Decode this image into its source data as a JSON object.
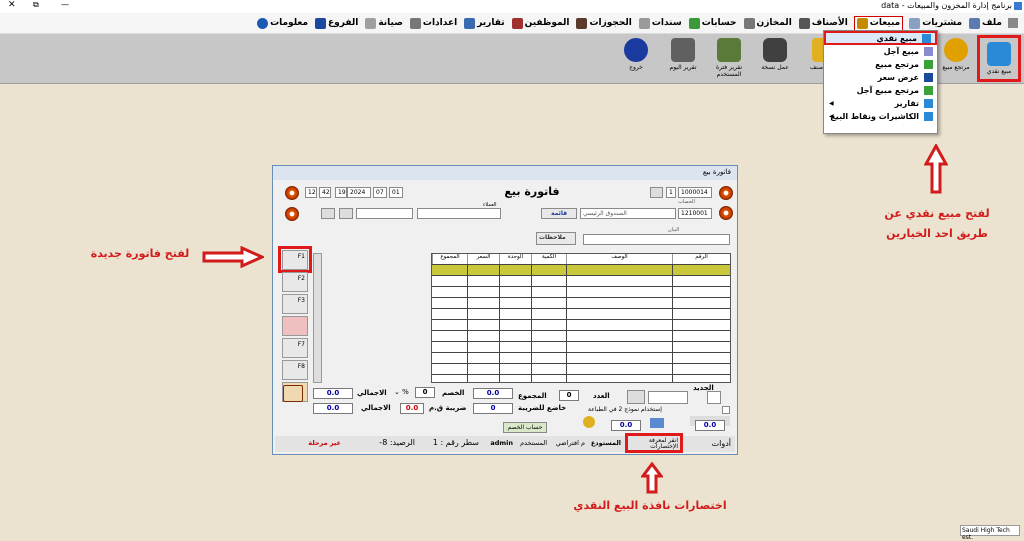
{
  "window": {
    "title": "برنامج إدارة المخزون والمبيعات - data",
    "controls": [
      "✕",
      "⧉",
      "—"
    ]
  },
  "menu": [
    {
      "label": "ملف",
      "color": "#5a7ab0"
    },
    {
      "label": "مشتريات",
      "color": "#8aa0c0"
    },
    {
      "label": "مبيعات",
      "color": "#c58a00"
    },
    {
      "label": "الأصناف",
      "color": "#555"
    },
    {
      "label": "المخازن",
      "color": "#777"
    },
    {
      "label": "حسابات",
      "color": "#3a9a3a"
    },
    {
      "label": "سندات",
      "color": "#9a9a9a"
    },
    {
      "label": "الحجوزات",
      "color": "#5a3a2a"
    },
    {
      "label": "الموظفين",
      "color": "#a03030"
    },
    {
      "label": "تقارير",
      "color": "#3a6ab0"
    },
    {
      "label": "اعدادات",
      "color": "#777"
    },
    {
      "label": "صيانة",
      "color": "#a0a0a0"
    },
    {
      "label": "الفروع",
      "color": "#1a4aa0"
    },
    {
      "label": "معلومات",
      "color": "#1a5ab0"
    }
  ],
  "toolbar": {
    "right": [
      {
        "label": "مبيع نقدي",
        "color": "#2a8ad8"
      },
      {
        "label": "مرتجع مبيع",
        "color": "#e0a000"
      },
      {
        "label": "",
        "color": "#4a9a4a"
      },
      {
        "label": "",
        "color": "#9a9ad8"
      },
      {
        "label": "",
        "color": "#e0c040"
      }
    ],
    "left": [
      {
        "label": "خروج",
        "color": "#1a3aa0"
      },
      {
        "label": "تقرير اليوم",
        "color": "#606060"
      },
      {
        "label": "تقرير فترة المستخدم",
        "color": "#5a7a3a"
      },
      {
        "label": "عمل نسخة",
        "color": "#404040"
      },
      {
        "label": "حذف صنف",
        "color": "#e0b020"
      }
    ]
  },
  "dropdown": [
    {
      "label": "مبيع نقدي",
      "color": "#2a8ad8",
      "sub": false
    },
    {
      "label": "مبيع آجل",
      "color": "#8a8ad0",
      "sub": false
    },
    {
      "label": "مرتجع مبيع",
      "color": "#3aa03a",
      "sub": false
    },
    {
      "label": "عرض سعر",
      "color": "#1a4a9a",
      "sub": false
    },
    {
      "label": "مرتجع مبيع آجل",
      "color": "#3aa03a",
      "sub": false
    },
    {
      "label": "تقارير",
      "color": "#2a8ad8",
      "sub": true
    },
    {
      "label": "الكاشيرات ونقاط البيع",
      "color": "#2a8ad8",
      "sub": true
    }
  ],
  "invoice": {
    "window_title": "فاتورة بيع",
    "heading": "فاتورة بيع",
    "invoice_no": "1000014",
    "counter": "1",
    "date": {
      "day": "01",
      "month": "07",
      "year": "2024"
    },
    "time": {
      "h": "12",
      "m": "42",
      "s": "19"
    },
    "account_label": "الحساب",
    "account_code": "1210001",
    "account_name": "الصندوق الرئيسي",
    "list_button": "قائمة",
    "customer_label": "العملاء",
    "note_label": "البيان",
    "notes_button": "ملاحظات",
    "columns": [
      "الرقم",
      "الوصف",
      "الكمية",
      "الوحدة",
      "السعر",
      "المجموع"
    ],
    "side_keys": [
      "F1",
      "F2",
      "F3",
      "",
      "F7",
      "F8",
      ""
    ],
    "totals": {
      "barcode_label": "الجديد",
      "count_label": "العدد",
      "count": "0",
      "sum_label": "المجموع",
      "sum": "0.0",
      "discount_label": "الخصم",
      "discount": "0",
      "percent": "%",
      "total_label": "الاجمالي",
      "total": "0.0",
      "taxable_label": "خاضع للضريبة",
      "taxable": "0",
      "vat_label": "ضريبة ق.م",
      "vat": "0.0",
      "grand_label": "الاجمالي",
      "grand": "0.0",
      "print_option": "إستخدام نموذج 2 في الطباعة",
      "calc_discount": "حساب الخصم",
      "paid": "0.0",
      "change": "0.0"
    },
    "status": {
      "tools": "أدوات",
      "shortcuts": "انقر لمعرفة الإختصارات",
      "warehouse_label": "المستودع",
      "warehouse": "م افتراضي",
      "user_label": "المستخدم",
      "user": "admin",
      "line": "سطر رقم : 1",
      "balance": "الرصيد: 8-",
      "unposted": "غير مرحلة"
    }
  },
  "annotations": {
    "new_invoice": "لفتح فاتورة جديدة",
    "open_cash": "لفتح مبيع نقدي عن طريق احد الخيارين",
    "shortcuts": "اختصارات نافذة البيع النقدي",
    "colors": {
      "red": "#d21b1b"
    }
  },
  "footer": {
    "brand": "Saudi High Tech est."
  }
}
